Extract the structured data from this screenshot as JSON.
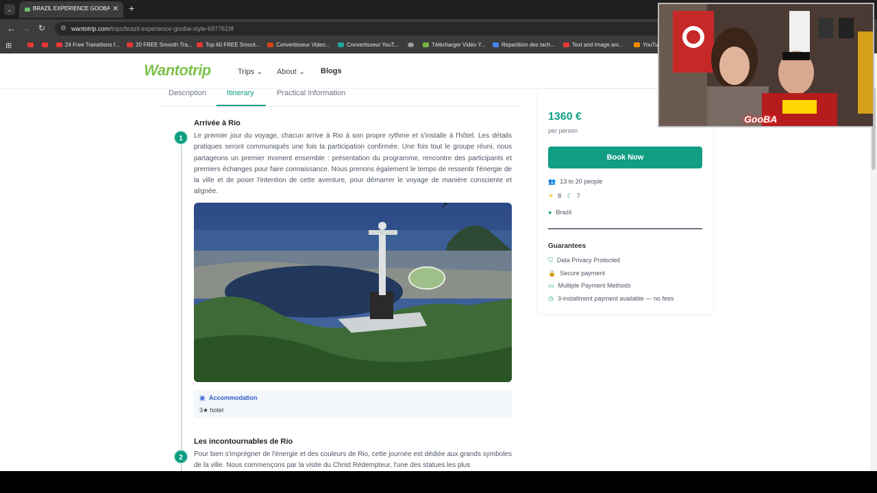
{
  "browser": {
    "tab_title": "BRAZIL EXPERIENCE GOOBA STYLE",
    "tab_close": "✕",
    "new_tab": "+",
    "url_host": "wantotrip.com",
    "url_path": "/trips/brazil-experience-gooba-style-6977619f",
    "bookmarks": [
      "",
      "",
      "24 Free Transitions f...",
      "20 FREE Smooth Tra...",
      "Top 60 FREE Smoot...",
      "Convertisseur Video...",
      "Convertisseur YouT...",
      "",
      "Télécharger Vidéo Y...",
      "Repartition des tach...",
      "Text and Image ani...",
      "YouTu"
    ]
  },
  "site": {
    "logo": "Wantotrip",
    "nav": {
      "trips": "Trips",
      "about": "About",
      "blogs": "Blogs"
    },
    "subtabs": [
      "Description",
      "Itinerary",
      "Practical Information"
    ]
  },
  "itinerary": {
    "days": [
      {
        "number": "1",
        "title": "Arrivée à Rio",
        "text": "Le premier jour du voyage, chacun arrive à Rio à son propre rythme et s'installe à l'hôtel. Les détails pratiques seront communiqués une fois la participation confirmée. Une fois tout le groupe réuni, nous partageons un premier moment ensemble : présentation du programme, rencontre des participants et premiers échanges pour faire connaissance. Nous prenons également le temps de ressentir l'énergie de la ville et de poser l'intention de cette aventure, pour démarrer le voyage de manière consciente et alignée."
      },
      {
        "number": "2",
        "title": "Les incontournables de Rio",
        "text": "Pour bien s'imprégner de l'énergie et des couleurs de Rio, cette journée est dédiée aux grands symboles de la ville. Nous commençons par la visite du Christ Rédempteur, l'une des statues les plus"
      }
    ],
    "accommodation": {
      "label": "Accommodation",
      "value": "3★ hotel"
    }
  },
  "booking": {
    "price": "1360 €",
    "per": "per person",
    "book_label": "Book Now",
    "group_size": "13 to 20 people",
    "days": "8",
    "nights": "7",
    "destination": "Brazil",
    "guarantees_title": "Guarantees",
    "guarantees": [
      "Data Privacy Protected",
      "Secure payment",
      "Multiple Payment Methods",
      "3-installment payment available — no fees"
    ]
  },
  "overlay": {
    "webcam_label": "GooBA"
  },
  "colors": {
    "accent": "#0f9e83",
    "logo_green": "#7cc24a"
  }
}
